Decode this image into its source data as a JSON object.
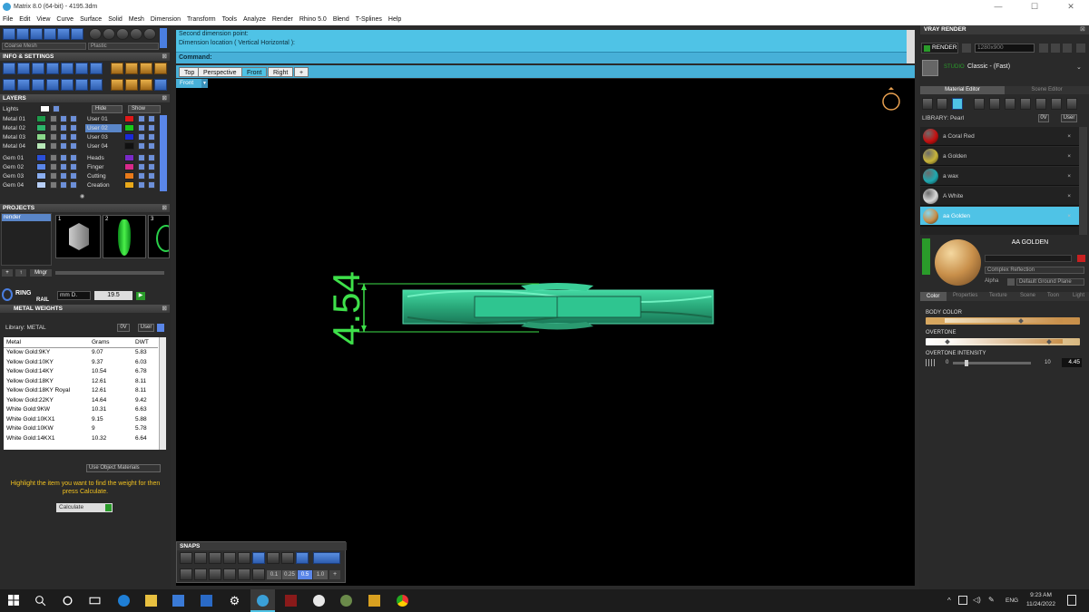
{
  "window": {
    "title": "Matrix 8.0 (64-bit) - 4195.3dm",
    "minimize": "—",
    "maximize": "☐",
    "close": "✕"
  },
  "menu": [
    "File",
    "Edit",
    "View",
    "Curve",
    "Surface",
    "Solid",
    "Mesh",
    "Dimension",
    "Transform",
    "Tools",
    "Analyze",
    "Render",
    "Rhino 5.0",
    "Blend",
    "T-Splines",
    "Help"
  ],
  "left": {
    "mesh_select": "Coarse Mesh",
    "material_select": "Plastic",
    "info_settings": "INFO & SETTINGS",
    "layers_title": "LAYERS",
    "lights": "Lights",
    "hide": "Hide",
    "show": "Show",
    "layers_left": [
      "Metal 01",
      "Metal 02",
      "Metal 03",
      "Metal 04",
      "Gem 01",
      "Gem 02",
      "Gem 03",
      "Gem 04"
    ],
    "layers_right": [
      "User 01",
      "User 02",
      "User 03",
      "User 04",
      "Heads",
      "Finger",
      "Cutting",
      "Creation"
    ],
    "projects_title": "PROJECTS",
    "project_item": "render",
    "project_thumbs": [
      "1",
      "2",
      "3"
    ],
    "mngr": "Mngr",
    "ring_rail": {
      "label1": "RING",
      "label2": "RAIL",
      "unit": "mm D.",
      "value": "19.5"
    },
    "metal_weights": {
      "title": "METAL WEIGHTS",
      "library": "Library: METAL",
      "lib_btn1": "0V",
      "lib_btn2": "User",
      "headers": [
        "Metal",
        "Grams",
        "DWT"
      ],
      "rows": [
        [
          "Yellow Gold:9KY",
          "9.07",
          "5.83"
        ],
        [
          "Yellow Gold:10KY",
          "9.37",
          "6.03"
        ],
        [
          "Yellow Gold:14KY",
          "10.54",
          "6.78"
        ],
        [
          "Yellow Gold:18KY",
          "12.61",
          "8.11"
        ],
        [
          "Yellow Gold:18KY Royal",
          "12.61",
          "8.11"
        ],
        [
          "Yellow Gold:22KY",
          "14.64",
          "9.42"
        ],
        [
          "White Gold:9KW",
          "10.31",
          "6.63"
        ],
        [
          "White Gold:10KX1",
          "9.15",
          "5.88"
        ],
        [
          "White Gold:10KW",
          "9",
          "5.78"
        ],
        [
          "White Gold:14KX1",
          "10.32",
          "6.64"
        ]
      ],
      "use_object_materials": "Use Object Materials",
      "instructions": "Highlight the item you want to find the weight for then press Calculate.",
      "calculate": "Calculate"
    }
  },
  "command": {
    "line1": "Second dimension point:",
    "line2": "Dimension location ( Vertical  Horizontal ):",
    "label": "Command:"
  },
  "viewport": {
    "tabs": [
      "Top",
      "Perspective",
      "Front",
      "Right"
    ],
    "active_tab": "Front",
    "view_label": "Front",
    "dimension": "4.54"
  },
  "snaps": {
    "title": "SNAPS",
    "values": [
      "0.1",
      "0.25",
      "0.5",
      "1.0"
    ]
  },
  "right": {
    "title": "VRAY RENDER",
    "render": "RENDER",
    "resolution": "1280x900",
    "studio": "Classic - (Fast)",
    "studio_label": "STUDIO",
    "tabs_top": [
      "Material Editor",
      "Scene Editor"
    ],
    "library": "LIBRARY: Pearl",
    "lib_btn1": "0V",
    "lib_btn2": "User",
    "materials": [
      {
        "name": "a Coral Red",
        "color": "#c41010"
      },
      {
        "name": "a Golden",
        "color": "#c8b43a"
      },
      {
        "name": "a wax",
        "color": "#1fa8b0"
      },
      {
        "name": "A White",
        "color": "#d8d8d8"
      },
      {
        "name": "aa Golden",
        "color": "#c88f4a"
      }
    ],
    "selected_material": "AA  GOLDEN",
    "reflection": "Complex Reflection",
    "alpha": "Alpha",
    "ground": "Default Ground Plane",
    "tabs_bottom": [
      "Color",
      "Properties",
      "Texture",
      "Scene",
      "Toon",
      "Light"
    ],
    "body_color_label": "BODY COLOR",
    "overtone_label": "OVERTONE",
    "overtone_intensity_label": "OVERTONE INTENSITY",
    "intensity_min": "0",
    "intensity_max": "10",
    "intensity_value": "4.45",
    "intensity_level": 0.445
  },
  "taskbar": {
    "time": "9:23 AM",
    "date": "11/24/2022",
    "lang": "ENG"
  },
  "colors": {
    "accent": "#4fc3e6",
    "model": "#2fb58a",
    "dimension": "#3ee04a"
  }
}
